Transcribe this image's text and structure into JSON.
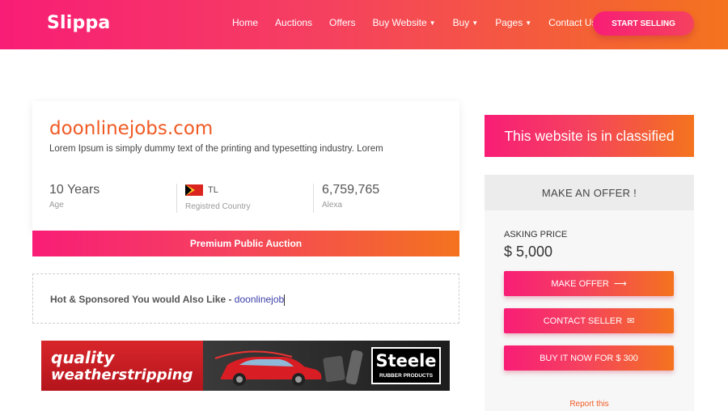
{
  "header": {
    "logo": "Slippa",
    "nav": [
      {
        "label": "Home",
        "dropdown": false
      },
      {
        "label": "Auctions",
        "dropdown": false
      },
      {
        "label": "Offers",
        "dropdown": false
      },
      {
        "label": "Buy Website",
        "dropdown": true
      },
      {
        "label": "Buy",
        "dropdown": true
      },
      {
        "label": "Pages",
        "dropdown": true
      },
      {
        "label": "Contact Us",
        "dropdown": false
      }
    ],
    "cta": "START SELLING"
  },
  "listing": {
    "domain": "doonlinejobs.com",
    "description": "Lorem Ipsum is simply dummy text of the printing and typesetting industry. Lorem",
    "stats": {
      "age_value": "10 Years",
      "age_label": "Age",
      "country_code": "TL",
      "country_label": "Registred Country",
      "alexa_value": "6,759,765",
      "alexa_label": "Alexa"
    },
    "auction_label": "Premium Public Auction"
  },
  "sponsored": {
    "label": "Hot & Sponsored You would Also Like - ",
    "query": "doonlinejob"
  },
  "ad": {
    "line1": "quality",
    "line2": "weatherstripping",
    "brand": "Steele",
    "brand_sub": "RUBBER PRODUCTS"
  },
  "sidebar": {
    "classified": "This website is in classified",
    "offer_title": "MAKE AN OFFER !",
    "asking_label": "ASKING PRICE",
    "asking_price": "$ 5,000",
    "buttons": {
      "make_offer": "MAKE OFFER",
      "contact_seller": "CONTACT SELLER",
      "buy_now": "BUY IT NOW FOR $ 300"
    },
    "report": "Report this"
  },
  "colors": {
    "gradient_start": "#f81d76",
    "gradient_end": "#f4731e",
    "domain_title": "#f05a24",
    "link": "#3c3fa8"
  }
}
